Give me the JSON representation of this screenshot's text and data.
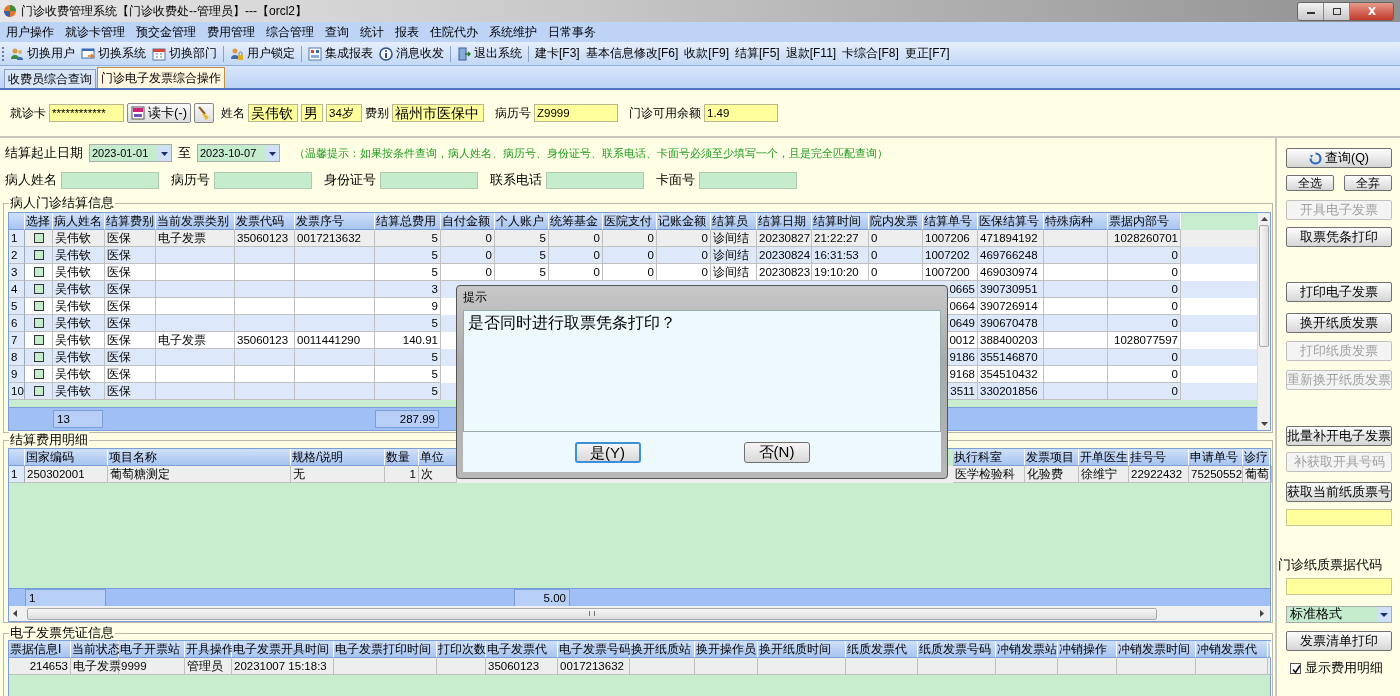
{
  "window": {
    "title": "门诊收费管理系统【门诊收费处--管理员】---【orcl2】"
  },
  "menu": [
    "用户操作",
    "就诊卡管理",
    "预交金管理",
    "费用管理",
    "综合管理",
    "查询",
    "统计",
    "报表",
    "住院代办",
    "系统维护",
    "日常事务"
  ],
  "toolbar": [
    {
      "label": "切换用户",
      "kind": "icon",
      "separator_before": false
    },
    {
      "label": "切换系统",
      "kind": "icon",
      "separator_before": false
    },
    {
      "label": "切换部门",
      "kind": "icon",
      "separator_before": false
    },
    {
      "label": "用户锁定",
      "kind": "icon",
      "separator_before": true
    },
    {
      "label": "集成报表",
      "kind": "icon",
      "separator_before": true
    },
    {
      "label": "消息收发",
      "kind": "icon",
      "separator_before": false
    },
    {
      "label": "退出系统",
      "kind": "icon",
      "separator_before": true
    },
    {
      "label": "建卡[F3]",
      "kind": "text",
      "separator_before": true
    },
    {
      "label": "基本信息修改[F6]",
      "kind": "text",
      "separator_before": false
    },
    {
      "label": "收款[F9]",
      "kind": "text",
      "separator_before": false
    },
    {
      "label": "结算[F5]",
      "kind": "text",
      "separator_before": false
    },
    {
      "label": "退款[F11]",
      "kind": "text",
      "separator_before": false
    },
    {
      "label": "卡综合[F8]",
      "kind": "text",
      "separator_before": false
    },
    {
      "label": "更正[F7]",
      "kind": "text",
      "separator_before": false
    }
  ],
  "tabs": [
    {
      "label": "收费员综合查询",
      "selected": false
    },
    {
      "label": "门诊电子发票综合操作",
      "selected": true
    }
  ],
  "patient": {
    "card_label": "就诊卡",
    "card_value": "************",
    "read_button": "读卡(-)",
    "name_label": "姓名",
    "name": "吴伟钦",
    "sex": "男",
    "age": "34岁",
    "fee_type_label": "费别",
    "fee_type": "福州市医保中",
    "record_label": "病历号",
    "record_no": "Z9999",
    "balance_label": "门诊可用余额",
    "balance": "1.49"
  },
  "query": {
    "date_label": "结算起止日期",
    "start_date": "2023-01-01",
    "to_label": "至",
    "end_date": "2023-10-07",
    "hint": "（温馨提示：如果按条件查询，病人姓名、病历号、身份证号、联系电话、卡面号必须至少填写一个，且是完全匹配查询）",
    "fields": [
      {
        "label": "病人姓名"
      },
      {
        "label": "病历号"
      },
      {
        "label": "身份证号"
      },
      {
        "label": "联系电话"
      },
      {
        "label": "卡面号"
      }
    ]
  },
  "settlements": {
    "title": "病人门诊结算信息",
    "select_column": "选择",
    "columns": [
      "病人姓名",
      "结算费别",
      "当前发票类别",
      "发票代码",
      "发票序号",
      "结算总费用",
      "自付金额",
      "个人账户",
      "统筹基金",
      "医院支付",
      "记账金额",
      "结算员",
      "结算日期",
      "结算时间",
      "院内发票",
      "结算单号",
      "医保结算号",
      "特殊病种",
      "票据内部号"
    ],
    "rows": [
      {
        "number": "1",
        "checked": false,
        "selected": true,
        "cells": [
          "吴伟钦",
          "医保",
          "电子发票",
          "35060123",
          "0017213632",
          "5",
          "0",
          "5",
          "0",
          "0",
          "0",
          "诊间结",
          "20230827",
          "21:22:27",
          "0",
          "1007206",
          "471894192",
          null,
          "1028260701"
        ]
      },
      {
        "number": "2",
        "checked": false,
        "selected": false,
        "cells": [
          "吴伟钦",
          "医保",
          null,
          null,
          null,
          "5",
          "0",
          "5",
          "0",
          "0",
          "0",
          "诊间结",
          "20230824",
          "16:31:53",
          "0",
          "1007202",
          "469766248",
          null,
          "0"
        ]
      },
      {
        "number": "3",
        "checked": false,
        "selected": false,
        "cells": [
          "吴伟钦",
          "医保",
          null,
          null,
          null,
          "5",
          "0",
          "5",
          "0",
          "0",
          "0",
          "诊间结",
          "20230823",
          "19:10:20",
          "0",
          "1007200",
          "469030974",
          null,
          "0"
        ]
      },
      {
        "number": "4",
        "checked": false,
        "selected": false,
        "cells": [
          "吴伟钦",
          "医保",
          null,
          null,
          null,
          "3",
          null,
          null,
          null,
          null,
          null,
          null,
          null,
          null,
          null,
          "0665",
          "390730951",
          null,
          "0"
        ]
      },
      {
        "number": "5",
        "checked": false,
        "selected": false,
        "cells": [
          "吴伟钦",
          "医保",
          null,
          null,
          null,
          "9",
          null,
          null,
          null,
          null,
          null,
          null,
          null,
          null,
          null,
          "0664",
          "390726914",
          null,
          "0"
        ]
      },
      {
        "number": "6",
        "checked": false,
        "selected": false,
        "cells": [
          "吴伟钦",
          "医保",
          null,
          null,
          null,
          "5",
          null,
          null,
          null,
          null,
          null,
          null,
          null,
          null,
          null,
          "0649",
          "390670478",
          null,
          "0"
        ]
      },
      {
        "number": "7",
        "checked": false,
        "selected": false,
        "cells": [
          "吴伟钦",
          "医保",
          "电子发票",
          "35060123",
          "0011441290",
          "140.91",
          null,
          null,
          null,
          null,
          null,
          null,
          null,
          null,
          null,
          "0012",
          "388400203",
          null,
          "1028077597"
        ]
      },
      {
        "number": "8",
        "checked": false,
        "selected": false,
        "cells": [
          "吴伟钦",
          "医保",
          null,
          null,
          null,
          "5",
          null,
          null,
          null,
          null,
          null,
          null,
          null,
          null,
          null,
          "9186",
          "355146870",
          null,
          "0"
        ]
      },
      {
        "number": "9",
        "checked": false,
        "selected": false,
        "cells": [
          "吴伟钦",
          "医保",
          null,
          null,
          null,
          "5",
          null,
          null,
          null,
          null,
          null,
          null,
          null,
          null,
          null,
          "9168",
          "354510432",
          null,
          "0"
        ]
      },
      {
        "number": "10",
        "checked": false,
        "selected": false,
        "cells": [
          "吴伟钦",
          "医保",
          null,
          null,
          null,
          "5",
          null,
          null,
          null,
          null,
          null,
          null,
          null,
          null,
          null,
          "3511",
          "330201856",
          null,
          "0"
        ]
      }
    ],
    "footer": {
      "count": "13",
      "total": "287.99"
    }
  },
  "details": {
    "title": "结算费用明细",
    "columns": [
      "国家编码",
      "项目名称",
      "规格/说明",
      "数量",
      "单位",
      null,
      null,
      null,
      "执行科室",
      "发票项目",
      "开单医生",
      "挂号号",
      "申请单号",
      "诊疗"
    ],
    "rows": [
      {
        "number": "1",
        "cells": [
          "250302001",
          "葡萄糖测定",
          "无",
          "1",
          "次",
          null,
          null,
          null,
          "医学检验科",
          "化验费",
          "徐维宁",
          "22922432",
          "75250552",
          "葡萄"
        ]
      }
    ],
    "footer": {
      "count": "1",
      "total": "5.00"
    }
  },
  "invoices": {
    "title": "电子发票凭证信息",
    "columns": [
      "票据信息I",
      "当前状态",
      "电子开票站",
      "开具操作",
      "电子发票开具时间",
      "电子发票打印时间",
      "打印次数",
      "电子发票代",
      "电子发票号码",
      "换开纸质站",
      "换开操作员",
      "换开纸质时间",
      "纸质发票代",
      "纸质发票号码",
      "冲销发票站",
      "冲销操作",
      "冲销发票时间",
      "冲销发票代"
    ],
    "rows": [
      {
        "cells": [
          "214653",
          "电子发票",
          "9999",
          "管理员",
          "20231007 15:18:3",
          null,
          null,
          "35060123",
          "0017213632",
          null,
          null,
          null,
          null,
          null,
          null,
          null,
          null,
          null
        ]
      }
    ]
  },
  "side_panel": [
    {
      "kind": "button",
      "label": "查询(Q)",
      "disabled": false
    },
    {
      "kind": "pair",
      "buttons": [
        {
          "label": "全选",
          "disabled": false
        },
        {
          "label": "全弃",
          "disabled": false
        }
      ]
    },
    {
      "kind": "button",
      "label": "开具电子发票",
      "disabled": true
    },
    {
      "kind": "button",
      "label": "取票凭条打印",
      "disabled": false
    },
    {
      "kind": "button",
      "label": "打印电子发票",
      "disabled": false
    },
    {
      "kind": "button",
      "label": "换开纸质发票",
      "disabled": false
    },
    {
      "kind": "button",
      "label": "打印纸质发票",
      "disabled": true
    },
    {
      "kind": "button",
      "label": "重新换开纸质发票",
      "disabled": true
    },
    {
      "kind": "button",
      "label": "批量补开电子发票",
      "disabled": false
    },
    {
      "kind": "button",
      "label": "补获取开具号码",
      "disabled": true
    },
    {
      "kind": "button",
      "label": "获取当前纸质票号",
      "disabled": false
    },
    {
      "kind": "field"
    },
    {
      "kind": "label",
      "label": "门诊纸质票据代码"
    },
    {
      "kind": "field"
    },
    {
      "kind": "select",
      "label": "标准格式"
    },
    {
      "kind": "button",
      "label": "发票清单打印",
      "disabled": false
    },
    {
      "kind": "checkbox",
      "label": "显示费用明细",
      "checked": true
    }
  ],
  "dialog": {
    "title": "提示",
    "message": "是否同时进行取票凭条打印？",
    "buttons": [
      {
        "label": "是(Y)",
        "focused": true
      },
      {
        "label": "否(N)",
        "focused": false
      }
    ]
  }
}
